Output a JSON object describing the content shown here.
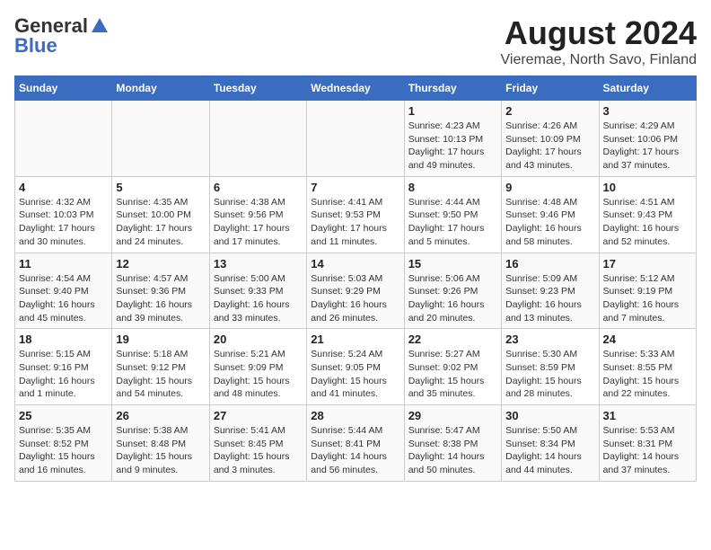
{
  "header": {
    "logo_general": "General",
    "logo_blue": "Blue",
    "title": "August 2024",
    "subtitle": "Vieremae, North Savo, Finland"
  },
  "weekdays": [
    "Sunday",
    "Monday",
    "Tuesday",
    "Wednesday",
    "Thursday",
    "Friday",
    "Saturday"
  ],
  "weeks": [
    [
      {
        "num": "",
        "info": ""
      },
      {
        "num": "",
        "info": ""
      },
      {
        "num": "",
        "info": ""
      },
      {
        "num": "",
        "info": ""
      },
      {
        "num": "1",
        "info": "Sunrise: 4:23 AM\nSunset: 10:13 PM\nDaylight: 17 hours\nand 49 minutes."
      },
      {
        "num": "2",
        "info": "Sunrise: 4:26 AM\nSunset: 10:09 PM\nDaylight: 17 hours\nand 43 minutes."
      },
      {
        "num": "3",
        "info": "Sunrise: 4:29 AM\nSunset: 10:06 PM\nDaylight: 17 hours\nand 37 minutes."
      }
    ],
    [
      {
        "num": "4",
        "info": "Sunrise: 4:32 AM\nSunset: 10:03 PM\nDaylight: 17 hours\nand 30 minutes."
      },
      {
        "num": "5",
        "info": "Sunrise: 4:35 AM\nSunset: 10:00 PM\nDaylight: 17 hours\nand 24 minutes."
      },
      {
        "num": "6",
        "info": "Sunrise: 4:38 AM\nSunset: 9:56 PM\nDaylight: 17 hours\nand 17 minutes."
      },
      {
        "num": "7",
        "info": "Sunrise: 4:41 AM\nSunset: 9:53 PM\nDaylight: 17 hours\nand 11 minutes."
      },
      {
        "num": "8",
        "info": "Sunrise: 4:44 AM\nSunset: 9:50 PM\nDaylight: 17 hours\nand 5 minutes."
      },
      {
        "num": "9",
        "info": "Sunrise: 4:48 AM\nSunset: 9:46 PM\nDaylight: 16 hours\nand 58 minutes."
      },
      {
        "num": "10",
        "info": "Sunrise: 4:51 AM\nSunset: 9:43 PM\nDaylight: 16 hours\nand 52 minutes."
      }
    ],
    [
      {
        "num": "11",
        "info": "Sunrise: 4:54 AM\nSunset: 9:40 PM\nDaylight: 16 hours\nand 45 minutes."
      },
      {
        "num": "12",
        "info": "Sunrise: 4:57 AM\nSunset: 9:36 PM\nDaylight: 16 hours\nand 39 minutes."
      },
      {
        "num": "13",
        "info": "Sunrise: 5:00 AM\nSunset: 9:33 PM\nDaylight: 16 hours\nand 33 minutes."
      },
      {
        "num": "14",
        "info": "Sunrise: 5:03 AM\nSunset: 9:29 PM\nDaylight: 16 hours\nand 26 minutes."
      },
      {
        "num": "15",
        "info": "Sunrise: 5:06 AM\nSunset: 9:26 PM\nDaylight: 16 hours\nand 20 minutes."
      },
      {
        "num": "16",
        "info": "Sunrise: 5:09 AM\nSunset: 9:23 PM\nDaylight: 16 hours\nand 13 minutes."
      },
      {
        "num": "17",
        "info": "Sunrise: 5:12 AM\nSunset: 9:19 PM\nDaylight: 16 hours\nand 7 minutes."
      }
    ],
    [
      {
        "num": "18",
        "info": "Sunrise: 5:15 AM\nSunset: 9:16 PM\nDaylight: 16 hours\nand 1 minute."
      },
      {
        "num": "19",
        "info": "Sunrise: 5:18 AM\nSunset: 9:12 PM\nDaylight: 15 hours\nand 54 minutes."
      },
      {
        "num": "20",
        "info": "Sunrise: 5:21 AM\nSunset: 9:09 PM\nDaylight: 15 hours\nand 48 minutes."
      },
      {
        "num": "21",
        "info": "Sunrise: 5:24 AM\nSunset: 9:05 PM\nDaylight: 15 hours\nand 41 minutes."
      },
      {
        "num": "22",
        "info": "Sunrise: 5:27 AM\nSunset: 9:02 PM\nDaylight: 15 hours\nand 35 minutes."
      },
      {
        "num": "23",
        "info": "Sunrise: 5:30 AM\nSunset: 8:59 PM\nDaylight: 15 hours\nand 28 minutes."
      },
      {
        "num": "24",
        "info": "Sunrise: 5:33 AM\nSunset: 8:55 PM\nDaylight: 15 hours\nand 22 minutes."
      }
    ],
    [
      {
        "num": "25",
        "info": "Sunrise: 5:35 AM\nSunset: 8:52 PM\nDaylight: 15 hours\nand 16 minutes."
      },
      {
        "num": "26",
        "info": "Sunrise: 5:38 AM\nSunset: 8:48 PM\nDaylight: 15 hours\nand 9 minutes."
      },
      {
        "num": "27",
        "info": "Sunrise: 5:41 AM\nSunset: 8:45 PM\nDaylight: 15 hours\nand 3 minutes."
      },
      {
        "num": "28",
        "info": "Sunrise: 5:44 AM\nSunset: 8:41 PM\nDaylight: 14 hours\nand 56 minutes."
      },
      {
        "num": "29",
        "info": "Sunrise: 5:47 AM\nSunset: 8:38 PM\nDaylight: 14 hours\nand 50 minutes."
      },
      {
        "num": "30",
        "info": "Sunrise: 5:50 AM\nSunset: 8:34 PM\nDaylight: 14 hours\nand 44 minutes."
      },
      {
        "num": "31",
        "info": "Sunrise: 5:53 AM\nSunset: 8:31 PM\nDaylight: 14 hours\nand 37 minutes."
      }
    ]
  ]
}
